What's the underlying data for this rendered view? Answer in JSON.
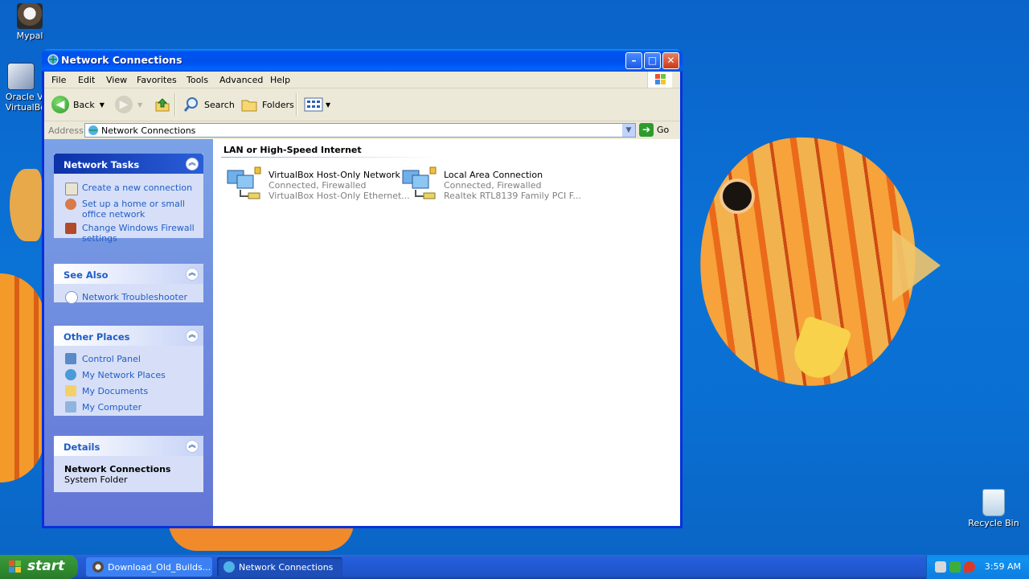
{
  "desktop": {
    "icons": [
      {
        "label": "Mypal"
      },
      {
        "label": "Oracle VM VirtualBox"
      },
      {
        "label": "Recycle Bin"
      }
    ]
  },
  "window": {
    "title": "Network Connections",
    "controls": {
      "minimize": "–",
      "maximize": "□",
      "close": "✕"
    },
    "menu": [
      "File",
      "Edit",
      "View",
      "Favorites",
      "Tools",
      "Advanced",
      "Help"
    ],
    "toolbar": {
      "back": "Back",
      "search": "Search",
      "folders": "Folders"
    },
    "address": {
      "label": "Address",
      "value": "Network Connections",
      "go": "Go"
    }
  },
  "leftpane": {
    "network_tasks": {
      "title": "Network Tasks",
      "links": [
        "Create a new connection",
        "Set up a home or small office network",
        "Change Windows Firewall settings"
      ]
    },
    "see_also": {
      "title": "See Also",
      "links": [
        "Network Troubleshooter"
      ]
    },
    "other_places": {
      "title": "Other Places",
      "links": [
        "Control Panel",
        "My Network Places",
        "My Documents",
        "My Computer"
      ]
    },
    "details": {
      "title": "Details",
      "name": "Network Connections",
      "type": "System Folder"
    }
  },
  "content": {
    "group_title": "LAN or High-Speed Internet",
    "connections": [
      {
        "name": "VirtualBox Host-Only Network",
        "status": "Connected, Firewalled",
        "device": "VirtualBox Host-Only Ethernet..."
      },
      {
        "name": "Local Area Connection",
        "status": "Connected, Firewalled",
        "device": "Realtek RTL8139 Family PCI F..."
      }
    ]
  },
  "taskbar": {
    "start": "start",
    "tasks": [
      {
        "label": "Download_Old_Builds..."
      },
      {
        "label": "Network Connections"
      }
    ],
    "clock": "3:59 AM"
  }
}
